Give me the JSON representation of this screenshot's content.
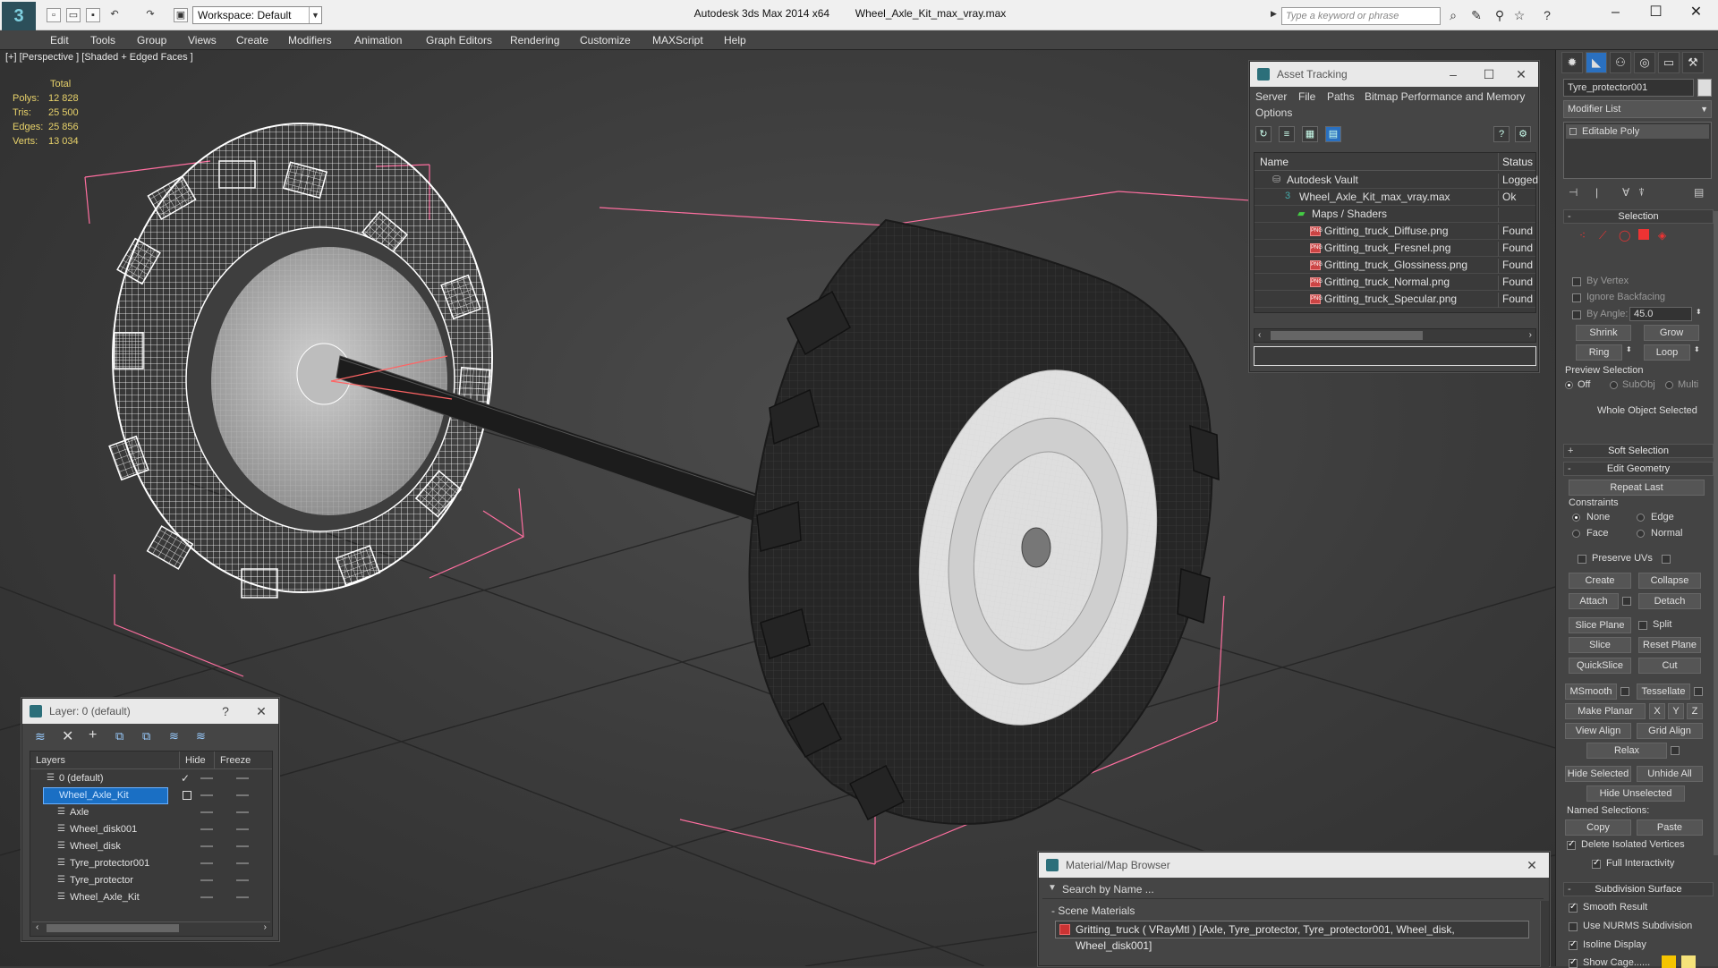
{
  "titlebar": {
    "workspace": "Workspace: Default",
    "app_name": "Autodesk 3ds Max  2014 x64",
    "file_name": "Wheel_Axle_Kit_max_vray.max",
    "search_placeholder": "Type a keyword or phrase"
  },
  "menu": [
    "Edit",
    "Tools",
    "Group",
    "Views",
    "Create",
    "Modifiers",
    "Animation",
    "Graph Editors",
    "Rendering",
    "Customize",
    "MAXScript",
    "Help"
  ],
  "viewport": {
    "label": "[+] [Perspective ] [Shaded + Edged Faces ]",
    "stats_header": "Total",
    "stats": [
      {
        "label": "Polys:",
        "value": "12 828"
      },
      {
        "label": "Tris:",
        "value": "25 500"
      },
      {
        "label": "Edges:",
        "value": "25 856"
      },
      {
        "label": "Verts:",
        "value": "13 034"
      }
    ]
  },
  "asset_tracking": {
    "title": "Asset Tracking",
    "menu": [
      "Server",
      "File",
      "Paths",
      "Bitmap Performance and Memory",
      "Options"
    ],
    "col_name": "Name",
    "col_status": "Status",
    "rows": [
      {
        "name": "Autodesk Vault",
        "status": "Logged",
        "indent": 0,
        "icon": "vault"
      },
      {
        "name": "Wheel_Axle_Kit_max_vray.max",
        "status": "Ok",
        "indent": 1,
        "icon": "max"
      },
      {
        "name": "Maps / Shaders",
        "status": "",
        "indent": 2,
        "icon": "maps"
      },
      {
        "name": "Gritting_truck_Diffuse.png",
        "status": "Found",
        "indent": 3,
        "icon": "png"
      },
      {
        "name": "Gritting_truck_Fresnel.png",
        "status": "Found",
        "indent": 3,
        "icon": "png"
      },
      {
        "name": "Gritting_truck_Glossiness.png",
        "status": "Found",
        "indent": 3,
        "icon": "png"
      },
      {
        "name": "Gritting_truck_Normal.png",
        "status": "Found",
        "indent": 3,
        "icon": "png"
      },
      {
        "name": "Gritting_truck_Specular.png",
        "status": "Found",
        "indent": 3,
        "icon": "png"
      }
    ]
  },
  "layers": {
    "title": "Layer: 0 (default)",
    "col_layers": "Layers",
    "col_hide": "Hide",
    "col_freeze": "Freeze",
    "rows": [
      {
        "name": "0 (default)",
        "indent": 1,
        "selected": false
      },
      {
        "name": "Wheel_Axle_Kit",
        "indent": 1,
        "selected": true
      },
      {
        "name": "Axle",
        "indent": 2,
        "selected": false
      },
      {
        "name": "Wheel_disk001",
        "indent": 2,
        "selected": false
      },
      {
        "name": "Wheel_disk",
        "indent": 2,
        "selected": false
      },
      {
        "name": "Tyre_protector001",
        "indent": 2,
        "selected": false
      },
      {
        "name": "Tyre_protector",
        "indent": 2,
        "selected": false
      },
      {
        "name": "Wheel_Axle_Kit",
        "indent": 2,
        "selected": false
      }
    ]
  },
  "material_browser": {
    "title": "Material/Map Browser",
    "search_placeholder": "Search by Name ...",
    "section": "- Scene Materials",
    "material": "Gritting_truck  ( VRayMtl ) [Axle, Tyre_protector, Tyre_protector001, Wheel_disk, Wheel_disk001]"
  },
  "command_panel": {
    "object_name": "Tyre_protector001",
    "modifier_list": "Modifier List",
    "stack_item": "Editable Poly",
    "selection_head": "Selection",
    "by_vertex": "By Vertex",
    "ignore_backfacing": "Ignore Backfacing",
    "by_angle": "By Angle:",
    "angle_value": "45.0",
    "shrink": "Shrink",
    "grow": "Grow",
    "ring": "Ring",
    "loop": "Loop",
    "preview_selection": "Preview Selection",
    "preview_off": "Off",
    "preview_subobj": "SubObj",
    "preview_multi": "Multi",
    "whole_object": "Whole Object Selected",
    "soft_selection": "Soft Selection",
    "edit_geometry": "Edit Geometry",
    "repeat_last": "Repeat Last",
    "constraints": "Constraints",
    "c_none": "None",
    "c_edge": "Edge",
    "c_face": "Face",
    "c_normal": "Normal",
    "preserve_uvs": "Preserve UVs",
    "create": "Create",
    "collapse": "Collapse",
    "attach": "Attach",
    "detach": "Detach",
    "slice_plane": "Slice Plane",
    "split": "Split",
    "slice": "Slice",
    "reset_plane": "Reset Plane",
    "quickslice": "QuickSlice",
    "cut": "Cut",
    "msmooth": "MSmooth",
    "tessellate": "Tessellate",
    "make_planar": "Make Planar",
    "x": "X",
    "y": "Y",
    "z": "Z",
    "view_align": "View Align",
    "grid_align": "Grid Align",
    "relax": "Relax",
    "hide_selected": "Hide Selected",
    "unhide_all": "Unhide All",
    "hide_unselected": "Hide Unselected",
    "named_selections": "Named Selections:",
    "copy": "Copy",
    "paste": "Paste",
    "delete_isolated": "Delete Isolated Vertices",
    "full_interactivity": "Full Interactivity",
    "subdivision_surface": "Subdivision Surface",
    "smooth_result": "Smooth Result",
    "use_nurms": "Use NURMS Subdivision",
    "isoline_display": "Isoline Display",
    "show_cage": "Show Cage......"
  },
  "colors": {
    "accent_selection": "#1a6fc4",
    "bounding_box": "#ff6fa0",
    "stats_text": "#e8d26a"
  }
}
